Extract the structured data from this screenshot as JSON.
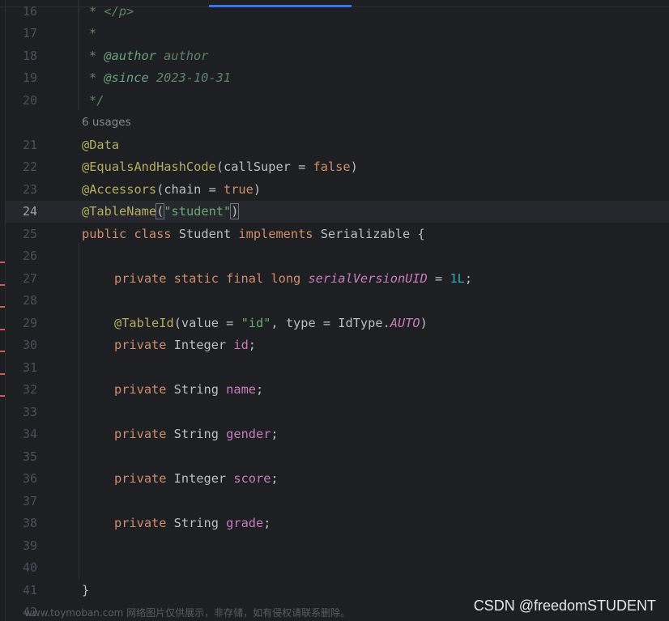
{
  "editor": {
    "line_numbers": [
      "16",
      "17",
      "18",
      "19",
      "20",
      "21",
      "22",
      "23",
      "24",
      "25",
      "26",
      "27",
      "28",
      "29",
      "30",
      "31",
      "32",
      "33",
      "34",
      "35",
      "36",
      "37",
      "38",
      "39",
      "40",
      "41",
      "42"
    ],
    "current_line": "24",
    "usages_hint": "6 usages",
    "code": {
      "l16": "* </p>",
      "l17": "*",
      "l18_star": "* ",
      "l18_tag": "@author",
      "l18_val": " author",
      "l19_star": "* ",
      "l19_tag": "@since",
      "l19_val": " 2023-10-31",
      "l20": "*/",
      "l21": "@Data",
      "l22_ann": "@EqualsAndHashCode",
      "l22_open": "(callSuper = ",
      "l22_val": "false",
      "l22_close": ")",
      "l23_ann": "@Accessors",
      "l23_open": "(chain = ",
      "l23_val": "true",
      "l23_close": ")",
      "l24_ann": "@TableName",
      "l24_open": "(",
      "l24_str": "\"student\"",
      "l24_close": ")",
      "l25_kw1": "public class",
      "l25_name": " Student ",
      "l25_kw2": "implements",
      "l25_rest": " Serializable {",
      "l27_kw": "private static final long ",
      "l27_field": "serialVersionUID",
      "l27_eq": " = ",
      "l27_num": "1L",
      "l27_end": ";",
      "l29_ann": "@TableId",
      "l29_a": "(value = ",
      "l29_str": "\"id\"",
      "l29_b": ", type = IdType.",
      "l29_const": "AUTO",
      "l29_c": ")",
      "l30_kw": "private",
      "l30_type": " Integer ",
      "l30_field": "id",
      "l30_end": ";",
      "l32_kw": "private",
      "l32_type": " String ",
      "l32_field": "name",
      "l32_end": ";",
      "l34_kw": "private",
      "l34_type": " String ",
      "l34_field": "gender",
      "l34_end": ";",
      "l36_kw": "private",
      "l36_type": " Integer ",
      "l36_field": "score",
      "l36_end": ";",
      "l38_kw": "private",
      "l38_type": " String ",
      "l38_field": "grade",
      "l38_end": ";",
      "l41": "}"
    }
  },
  "watermark": {
    "left": "www.toymoban.com 网络图片仅供展示，非存储，如有侵权请联系删除。",
    "right": "CSDN @freedomSTUDENT"
  },
  "colors": {
    "background": "#1e1f22",
    "keyword": "#cf8e6d",
    "annotation": "#b3ae60",
    "string": "#6aab73",
    "number": "#2aacb8",
    "field": "#c77dbb",
    "comment": "#5f826b",
    "accent": "#3574f0"
  }
}
